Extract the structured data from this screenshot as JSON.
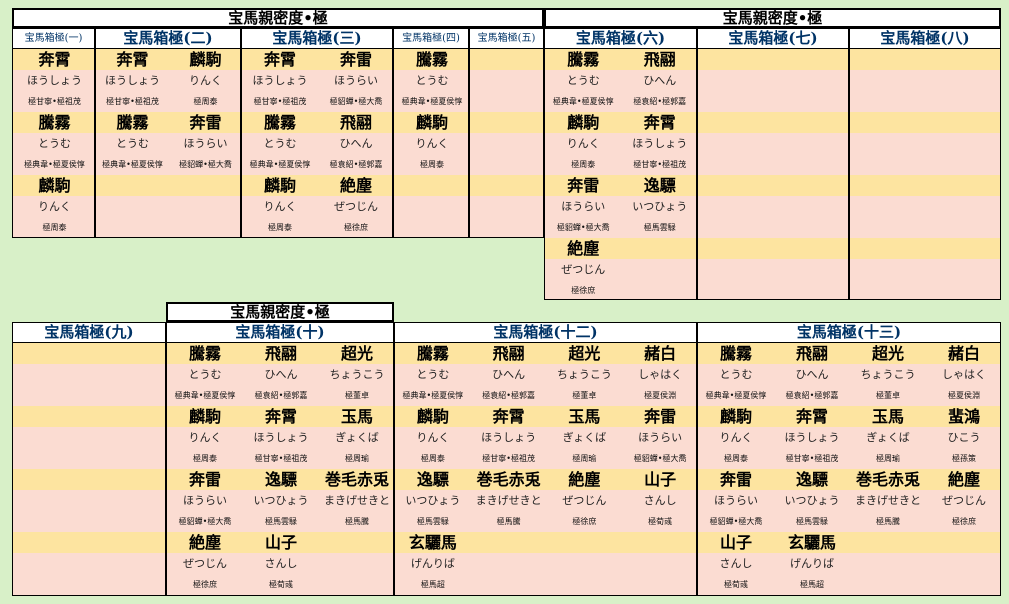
{
  "titles": [
    "宝馬親密度•極",
    "宝馬親密度•極",
    "宝馬親密度•極"
  ],
  "boxes": [
    {
      "header": "宝馬箱極(一)",
      "entries": [
        {
          "name": "奔霄",
          "reading": "ほうしょう",
          "bond": "極甘寧•極祖茂"
        },
        {
          "name": "騰霧",
          "reading": "とうむ",
          "bond": "極典韋•極夏侯惇"
        },
        {
          "name": "麟駒",
          "reading": "りんく",
          "bond": "極周泰"
        }
      ]
    },
    {
      "header": "宝馬箱極(二)",
      "entries": [
        {
          "name": "奔霄",
          "reading": "ほうしょう",
          "bond": "極甘寧•極祖茂"
        },
        {
          "name": "麟駒",
          "reading": "りんく",
          "bond": "極周泰"
        },
        {
          "name": "騰霧",
          "reading": "とうむ",
          "bond": "極典韋•極夏侯惇"
        },
        {
          "name": "奔雷",
          "reading": "ほうらい",
          "bond": "極貂蟬•極大喬"
        }
      ]
    },
    {
      "header": "宝馬箱極(三)",
      "entries": [
        {
          "name": "奔霄",
          "reading": "ほうしょう",
          "bond": "極甘寧•極祖茂"
        },
        {
          "name": "奔雷",
          "reading": "ほうらい",
          "bond": "極貂蟬•極大喬"
        },
        {
          "name": "騰霧",
          "reading": "とうむ",
          "bond": "極典韋•極夏侯惇"
        },
        {
          "name": "飛翮",
          "reading": "ひへん",
          "bond": "極袁紹•極郭嘉"
        },
        {
          "name": "麟駒",
          "reading": "りんく",
          "bond": "極周泰"
        },
        {
          "name": "絶塵",
          "reading": "ぜつじん",
          "bond": "極徐庶"
        }
      ]
    },
    {
      "header": "宝馬箱極(四)",
      "entries": [
        {
          "name": "騰霧",
          "reading": "とうむ",
          "bond": "極典韋•極夏侯惇"
        },
        {
          "name": "麟駒",
          "reading": "りんく",
          "bond": "極周泰"
        }
      ]
    },
    {
      "header": "宝馬箱極(五)",
      "entries": []
    },
    {
      "header": "宝馬箱極(六)",
      "entries": [
        {
          "name": "騰霧",
          "reading": "とうむ",
          "bond": "極典韋•極夏侯惇"
        },
        {
          "name": "飛翮",
          "reading": "ひへん",
          "bond": "極袁紹•極郭嘉"
        },
        {
          "name": "麟駒",
          "reading": "りんく",
          "bond": "極周泰"
        },
        {
          "name": "奔霄",
          "reading": "ほうしょう",
          "bond": "極甘寧•極祖茂"
        },
        {
          "name": "奔雷",
          "reading": "ほうらい",
          "bond": "極貂蟬•極大喬"
        },
        {
          "name": "逸驃",
          "reading": "いつひょう",
          "bond": "極馬雲騄"
        },
        {
          "name": "絶塵",
          "reading": "ぜつじん",
          "bond": "極徐庶"
        }
      ]
    },
    {
      "header": "宝馬箱極(七)",
      "entries": []
    },
    {
      "header": "宝馬箱極(八)",
      "entries": []
    },
    {
      "header": "宝馬箱極(九)",
      "entries": []
    },
    {
      "header": "宝馬箱極(十)",
      "entries": [
        {
          "name": "騰霧",
          "reading": "とうむ",
          "bond": "極典韋•極夏侯惇"
        },
        {
          "name": "飛翮",
          "reading": "ひへん",
          "bond": "極袁紹•極郭嘉"
        },
        {
          "name": "超光",
          "reading": "ちょうこう",
          "bond": "極董卓"
        },
        {
          "name": "麟駒",
          "reading": "りんく",
          "bond": "極周泰"
        },
        {
          "name": "奔霄",
          "reading": "ほうしょう",
          "bond": "極甘寧•極祖茂"
        },
        {
          "name": "玉馬",
          "reading": "ぎょくば",
          "bond": "極周瑜"
        },
        {
          "name": "奔雷",
          "reading": "ほうらい",
          "bond": "極貂蟬•極大喬"
        },
        {
          "name": "逸驃",
          "reading": "いつひょう",
          "bond": "極馬雲騄"
        },
        {
          "name": "巻毛赤兎",
          "reading": "まきげせきと",
          "bond": "極馬騰"
        },
        {
          "name": "絶塵",
          "reading": "ぜつじん",
          "bond": "極徐庶"
        },
        {
          "name": "山子",
          "reading": "さんし",
          "bond": "極荀彧"
        }
      ]
    },
    {
      "header": "宝馬箱極(十二)",
      "entries": [
        {
          "name": "騰霧",
          "reading": "とうむ",
          "bond": "極典韋•極夏侯惇"
        },
        {
          "name": "飛翮",
          "reading": "ひへん",
          "bond": "極袁紹•極郭嘉"
        },
        {
          "name": "超光",
          "reading": "ちょうこう",
          "bond": "極董卓"
        },
        {
          "name": "赭白",
          "reading": "しゃはく",
          "bond": "極夏侯淵"
        },
        {
          "name": "麟駒",
          "reading": "りんく",
          "bond": "極周泰"
        },
        {
          "name": "奔霄",
          "reading": "ほうしょう",
          "bond": "極甘寧•極祖茂"
        },
        {
          "name": "玉馬",
          "reading": "ぎょくば",
          "bond": "極周瑜"
        },
        {
          "name": "奔雷",
          "reading": "ほうらい",
          "bond": "極貂蟬•極大喬"
        },
        {
          "name": "逸驃",
          "reading": "いつひょう",
          "bond": "極馬雲騄"
        },
        {
          "name": "巻毛赤兎",
          "reading": "まきげせきと",
          "bond": "極馬騰"
        },
        {
          "name": "絶塵",
          "reading": "ぜつじん",
          "bond": "極徐庶"
        },
        {
          "name": "山子",
          "reading": "さんし",
          "bond": "極荀彧"
        },
        {
          "name": "玄驪馬",
          "reading": "げんりば",
          "bond": "極馬超"
        }
      ]
    },
    {
      "header": "宝馬箱極(十三)",
      "entries": [
        {
          "name": "騰霧",
          "reading": "とうむ",
          "bond": "極典韋•極夏侯惇"
        },
        {
          "name": "飛翮",
          "reading": "ひへん",
          "bond": "極袁紹•極郭嘉"
        },
        {
          "name": "超光",
          "reading": "ちょうこう",
          "bond": "極董卓"
        },
        {
          "name": "赭白",
          "reading": "しゃはく",
          "bond": "極夏侯淵"
        },
        {
          "name": "麟駒",
          "reading": "りんく",
          "bond": "極周泰"
        },
        {
          "name": "奔霄",
          "reading": "ほうしょう",
          "bond": "極甘寧•極祖茂"
        },
        {
          "name": "玉馬",
          "reading": "ぎょくば",
          "bond": "極周瑜"
        },
        {
          "name": "蜚鴻",
          "reading": "ひこう",
          "bond": "極孫策"
        },
        {
          "name": "奔雷",
          "reading": "ほうらい",
          "bond": "極貂蟬•極大喬"
        },
        {
          "name": "逸驃",
          "reading": "いつひょう",
          "bond": "極馬雲騄"
        },
        {
          "name": "巻毛赤兎",
          "reading": "まきげせきと",
          "bond": "極馬騰"
        },
        {
          "name": "絶塵",
          "reading": "ぜつじん",
          "bond": "極徐庶"
        },
        {
          "name": "山子",
          "reading": "さんし",
          "bond": "極荀彧"
        },
        {
          "name": "玄驪馬",
          "reading": "げんりば",
          "bond": "極馬超"
        }
      ]
    }
  ]
}
